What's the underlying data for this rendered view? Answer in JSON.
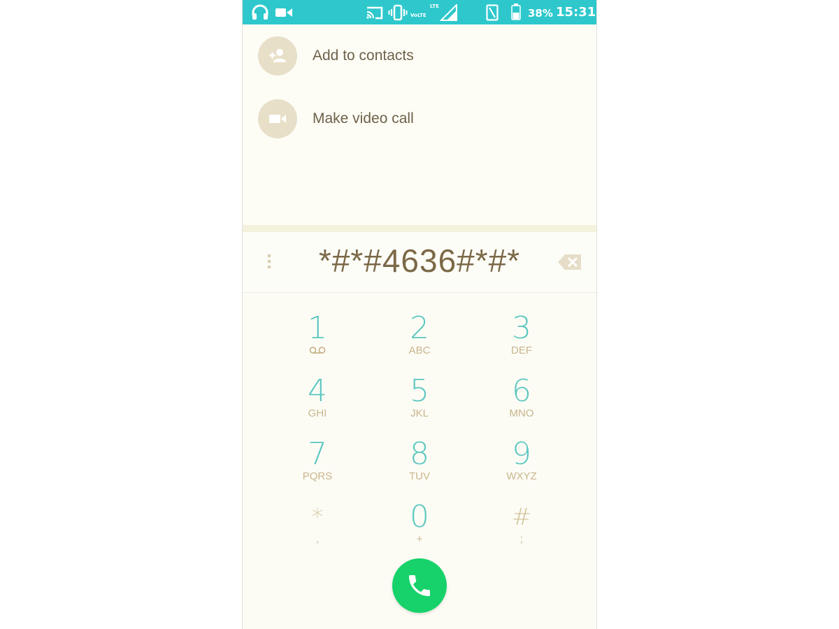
{
  "status_bar": {
    "battery_percent": "38%",
    "time": "15:31",
    "volte_label": "VoLTE",
    "lte_label": "LTE",
    "icons": [
      "headphones-icon",
      "video-camera-icon",
      "cast-icon",
      "vibrate-icon",
      "signal-icon",
      "nfc-icon",
      "battery-icon"
    ]
  },
  "suggestions": {
    "items": [
      {
        "label": "Add to contacts",
        "icon": "add-person-icon"
      },
      {
        "label": "Make video call",
        "icon": "video-call-icon"
      }
    ]
  },
  "dialer": {
    "digits": "*#*#4636#*#*"
  },
  "keypad": {
    "keys": [
      {
        "digit": "1",
        "letters": ""
      },
      {
        "digit": "2",
        "letters": "ABC"
      },
      {
        "digit": "3",
        "letters": "DEF"
      },
      {
        "digit": "4",
        "letters": "GHI"
      },
      {
        "digit": "5",
        "letters": "JKL"
      },
      {
        "digit": "6",
        "letters": "MNO"
      },
      {
        "digit": "7",
        "letters": "PQRS"
      },
      {
        "digit": "8",
        "letters": "TUV"
      },
      {
        "digit": "9",
        "letters": "WXYZ"
      },
      {
        "digit": "*",
        "letters": ","
      },
      {
        "digit": "0",
        "letters": "+"
      },
      {
        "digit": "#",
        "letters": ";"
      }
    ]
  },
  "colors": {
    "status_bar": "#2ec8cc",
    "digit": "#5cc6c0",
    "letters": "#c9b58c",
    "call_button": "#17d26a",
    "display_text": "#7b6947"
  }
}
